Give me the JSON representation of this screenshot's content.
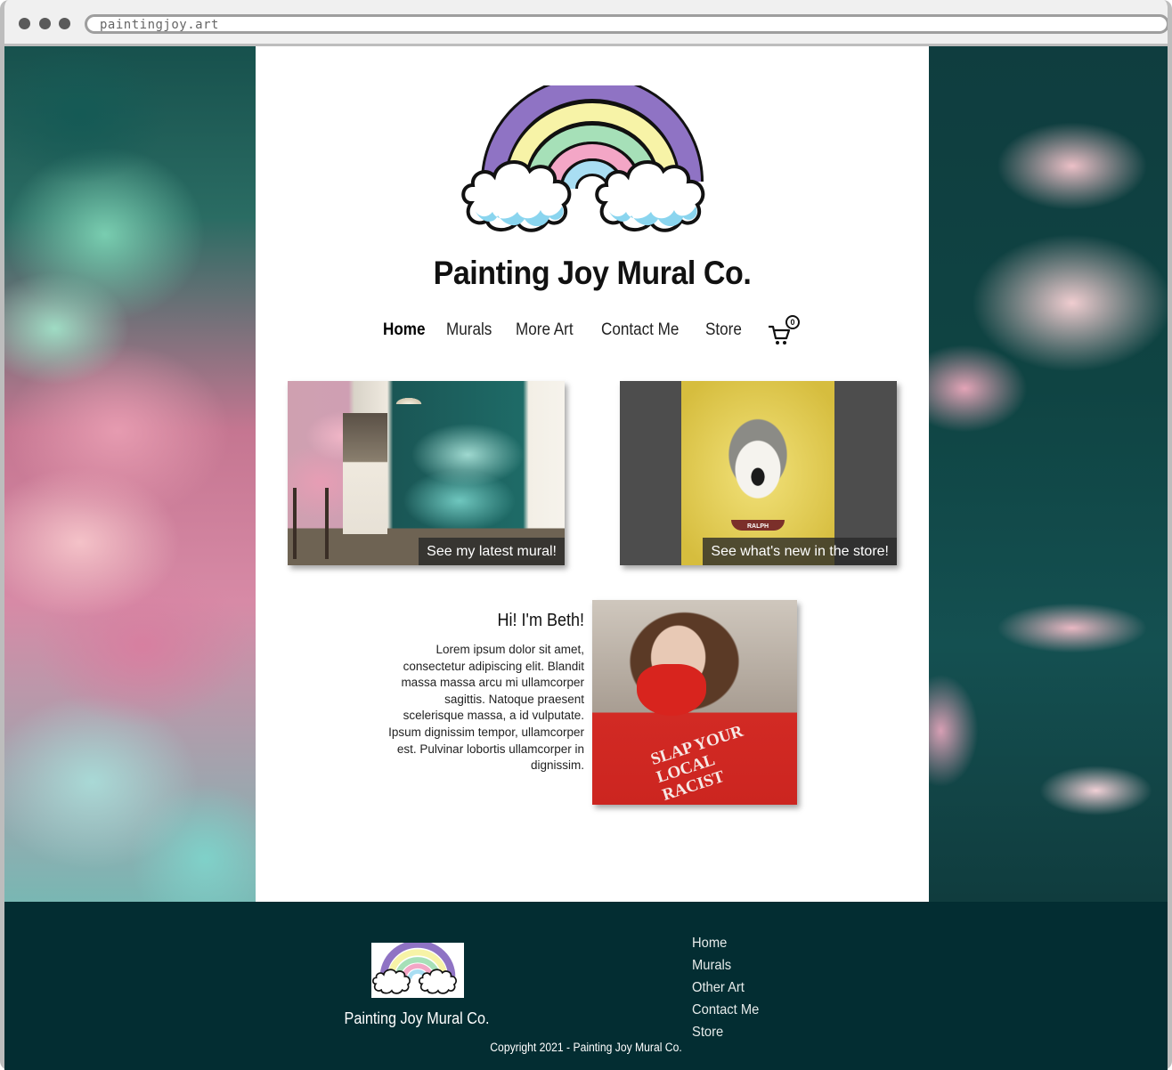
{
  "browser": {
    "url": "paintingjoy.art"
  },
  "site": {
    "title": "Painting Joy Mural Co."
  },
  "nav": {
    "items": [
      {
        "label": "Home",
        "active": true
      },
      {
        "label": "Murals",
        "active": false
      },
      {
        "label": "More Art",
        "active": false
      },
      {
        "label": "Contact Me",
        "active": false
      },
      {
        "label": "Store",
        "active": false
      }
    ],
    "cart_count": "0"
  },
  "cards": [
    {
      "caption": "See my latest mural!"
    },
    {
      "caption": "See what's new in the store!"
    }
  ],
  "bio": {
    "title": "Hi! I'm Beth!",
    "text": "Lorem ipsum dolor sit amet, consectetur adipiscing elit. Blandit massa massa arcu mi ullamcorper sagittis. Natoque praesent scelerisque massa, a id vulputate. Ipsum dignissim tempor, ullamcorper est. Pulvinar lobortis ullamcorper in dignissim.",
    "photo_shirt_text": "SLAP YOUR LOCAL RACIST",
    "photo_name_tag": "RALPH"
  },
  "footer": {
    "brand": "Painting Joy Mural Co.",
    "links": [
      "Home",
      "Murals",
      "Other Art",
      "Contact Me",
      "Store"
    ],
    "copyright": "Copyright 2021 - Painting Joy Mural Co."
  },
  "colors": {
    "footer_bg": "#032d32",
    "rainbow_purple": "#8f73c4",
    "rainbow_yellow": "#f7f3a7",
    "rainbow_green": "#a6e0b8",
    "rainbow_pink": "#f3a6c6",
    "rainbow_blue": "#a9def3",
    "cloud_blue": "#8ad5ef"
  }
}
